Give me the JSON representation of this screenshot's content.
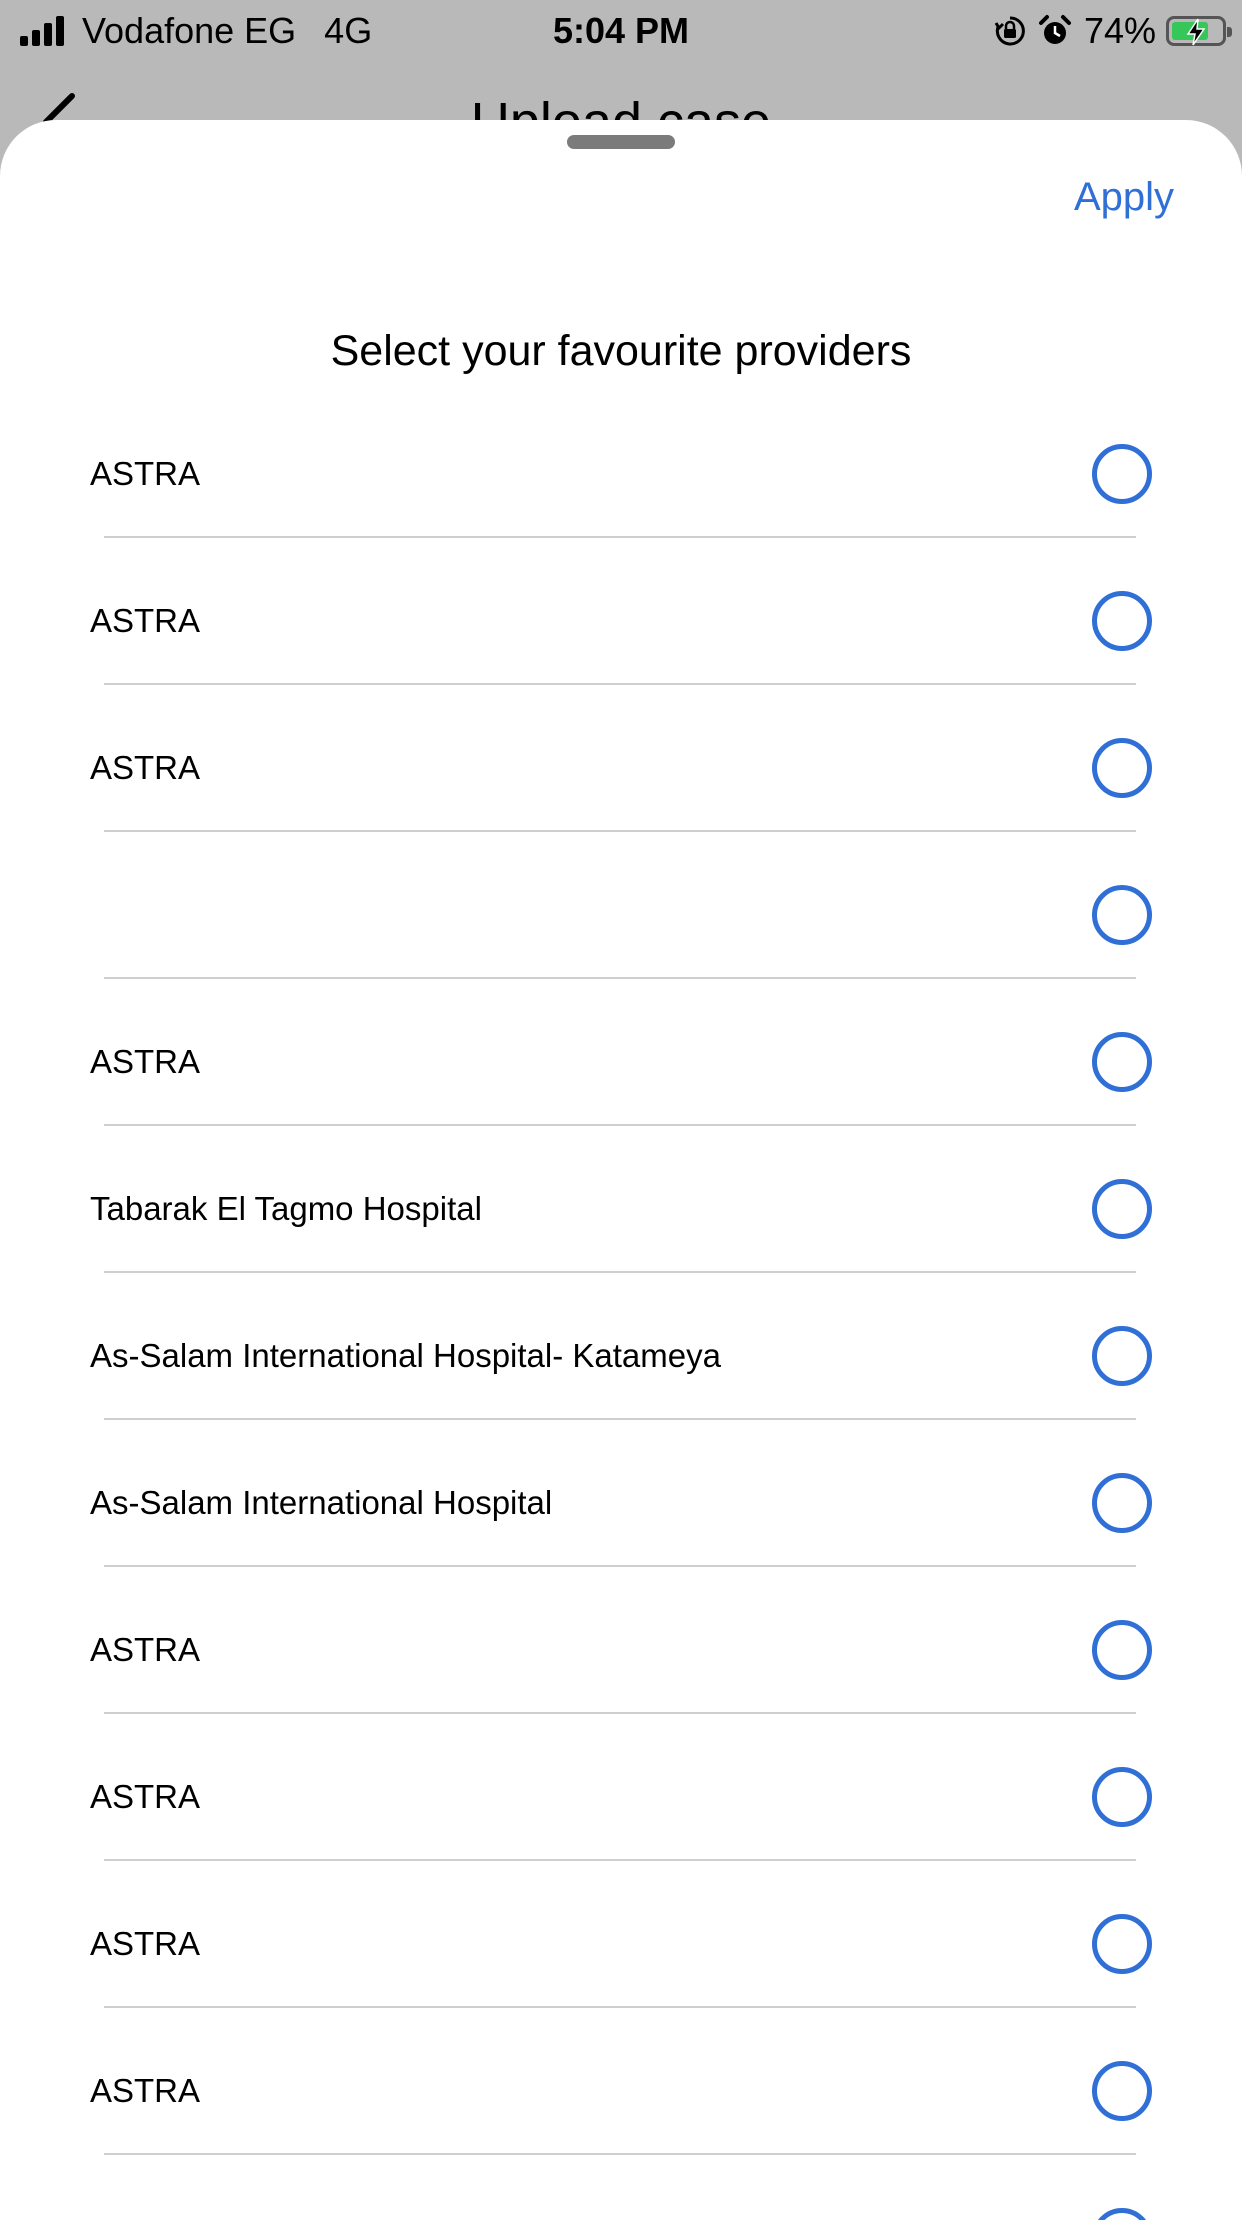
{
  "status_bar": {
    "carrier": "Vodafone EG",
    "network": "4G",
    "time": "5:04 PM",
    "battery_percent": "74%",
    "battery_level": 0.74,
    "icons": [
      "signal-icon",
      "orientation-lock-icon",
      "alarm-icon",
      "battery-charging-icon"
    ]
  },
  "background_page": {
    "title": "Upload case",
    "back_icon": "back-arrow-icon"
  },
  "sheet": {
    "apply_label": "Apply",
    "title": "Select your favourite providers",
    "accent_color": "#2f6fd6",
    "providers": [
      {
        "name": "ASTRA",
        "selected": false
      },
      {
        "name": "ASTRA",
        "selected": false
      },
      {
        "name": "ASTRA",
        "selected": false
      },
      {
        "name": "",
        "selected": false
      },
      {
        "name": "ASTRA",
        "selected": false
      },
      {
        "name": "Tabarak El Tagmo Hospital",
        "selected": false
      },
      {
        "name": "As-Salam International Hospital- Katameya",
        "selected": false
      },
      {
        "name": "As-Salam International Hospital",
        "selected": false
      },
      {
        "name": "ASTRA",
        "selected": false
      },
      {
        "name": "ASTRA",
        "selected": false
      },
      {
        "name": "ASTRA",
        "selected": false
      },
      {
        "name": "ASTRA",
        "selected": false
      },
      {
        "name": "",
        "selected": false
      }
    ]
  }
}
